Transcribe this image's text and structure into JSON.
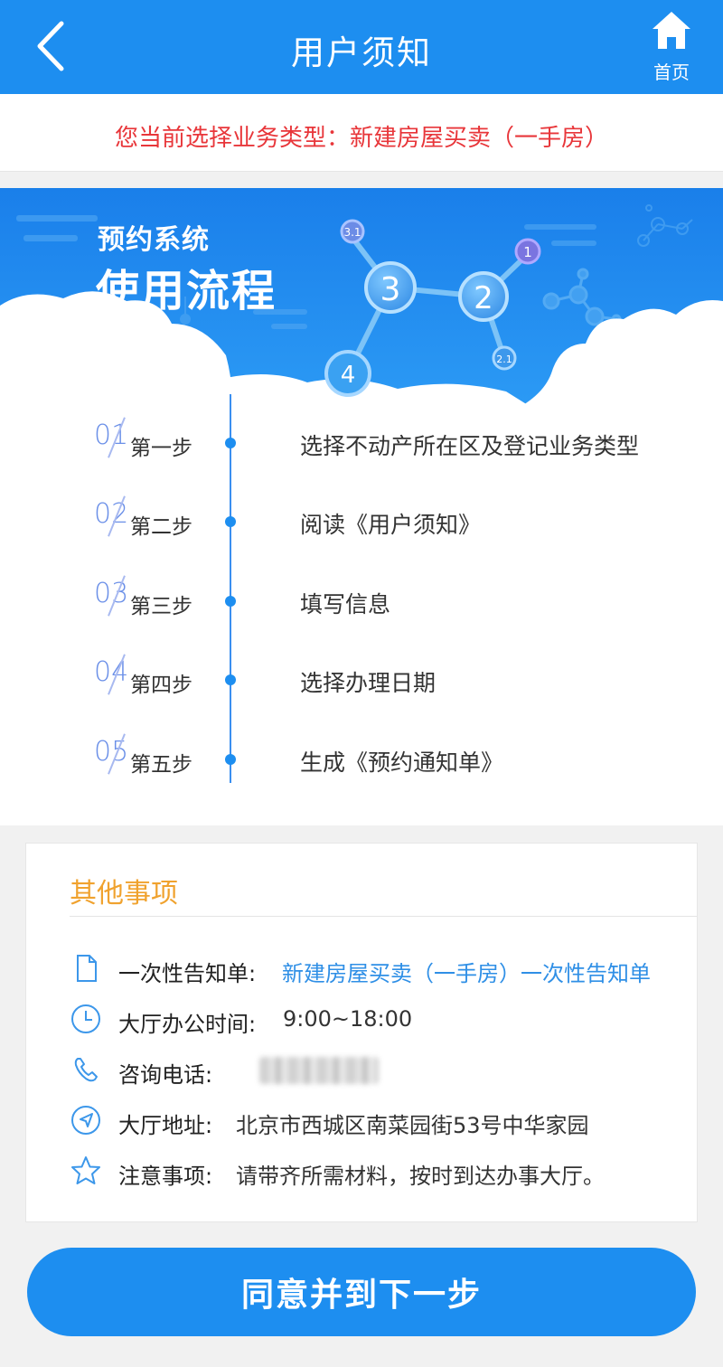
{
  "header": {
    "title": "用户须知",
    "home_label": "首页"
  },
  "business_type": {
    "text": "您当前选择业务类型：新建房屋买卖（一手房）"
  },
  "process": {
    "banner_subtitle": "预约系统",
    "banner_title": "使用流程",
    "molecule_labels": [
      "3.1",
      "1",
      "3",
      "2",
      "4",
      "2.1"
    ],
    "steps": [
      {
        "num": "01",
        "label": "第一步",
        "desc": "选择不动产所在区及登记业务类型"
      },
      {
        "num": "02",
        "label": "第二步",
        "desc": "阅读《用户须知》"
      },
      {
        "num": "03",
        "label": "第三步",
        "desc": "填写信息"
      },
      {
        "num": "04",
        "label": "第四步",
        "desc": "选择办理日期"
      },
      {
        "num": "05",
        "label": "第五步",
        "desc": "生成《预约通知单》"
      }
    ]
  },
  "other": {
    "title": "其他事项",
    "rows": [
      {
        "icon": "document-icon",
        "label": "一次性告知单:",
        "value": "新建房屋买卖（一手房）一次性告知单"
      },
      {
        "icon": "clock-icon",
        "label": "大厅办公时间:",
        "value": "9:00~18:00"
      },
      {
        "icon": "phone-icon",
        "label": "咨询电话:",
        "value": ""
      },
      {
        "icon": "location-arrow-icon",
        "label": "大厅地址:",
        "value": "北京市西城区南菜园街53号中华家园"
      },
      {
        "icon": "star-icon",
        "label": "注意事项:",
        "value": "请带齐所需材料，按时到达办事大厅。"
      }
    ]
  },
  "agree_button": {
    "label": "同意并到下一步"
  },
  "colors": {
    "primary": "#1d8ef0",
    "alert_red": "#e8363a",
    "section_orange": "#f0a22e",
    "link_blue": "#2f8fe6"
  }
}
